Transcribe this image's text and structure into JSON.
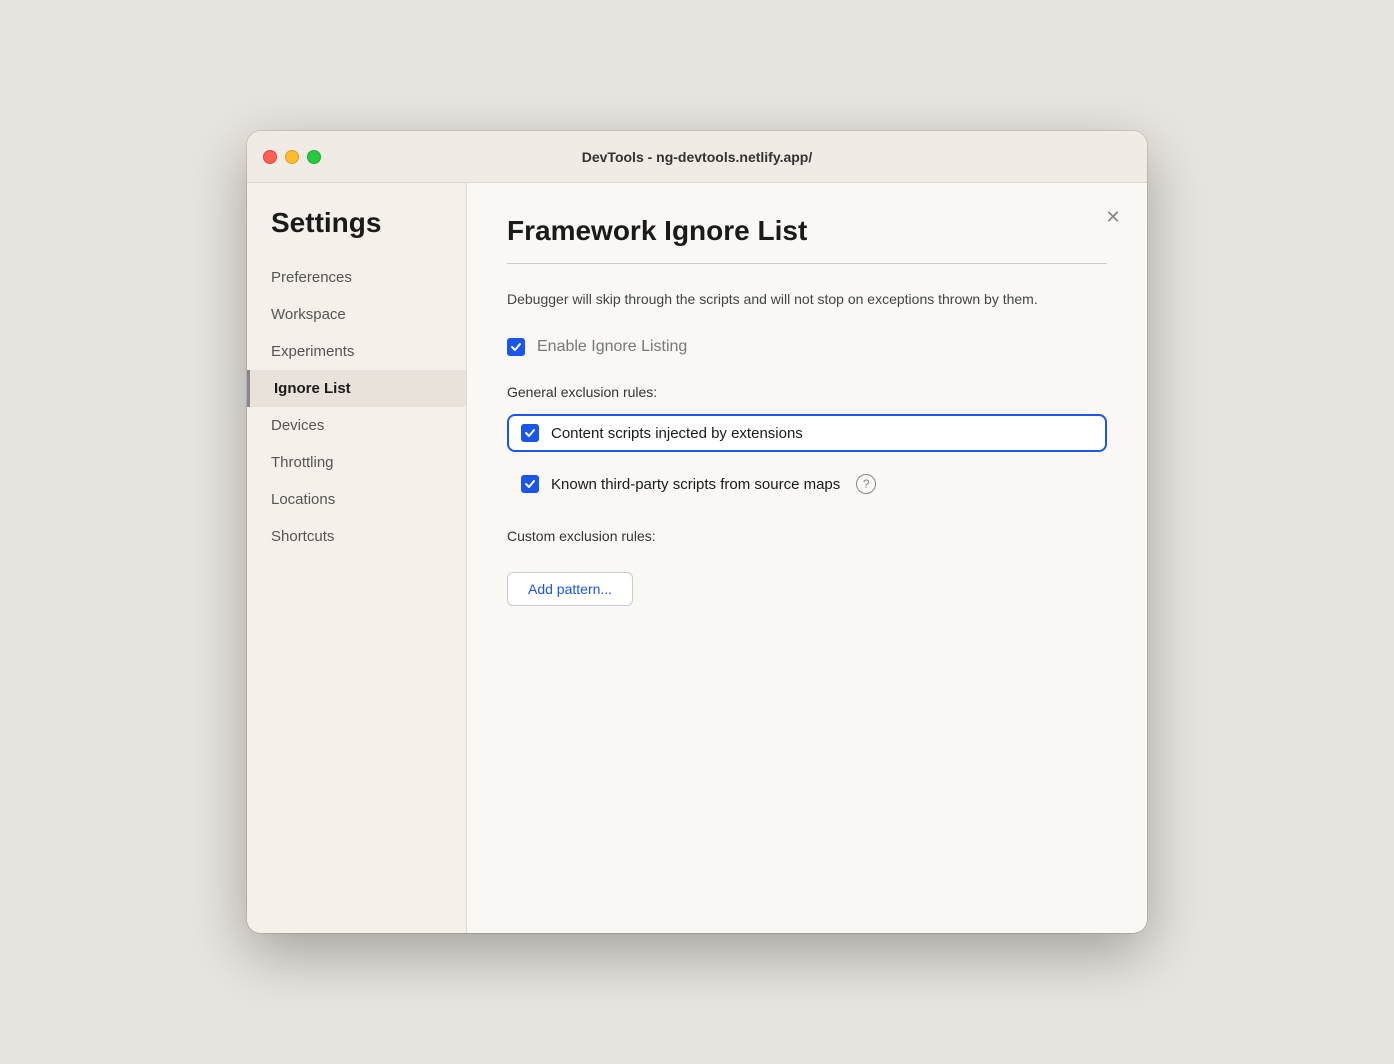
{
  "window": {
    "title": "DevTools - ng-devtools.netlify.app/"
  },
  "sidebar": {
    "title": "Settings",
    "items": [
      {
        "id": "preferences",
        "label": "Preferences",
        "active": false
      },
      {
        "id": "workspace",
        "label": "Workspace",
        "active": false
      },
      {
        "id": "experiments",
        "label": "Experiments",
        "active": false
      },
      {
        "id": "ignore-list",
        "label": "Ignore List",
        "active": true
      },
      {
        "id": "devices",
        "label": "Devices",
        "active": false
      },
      {
        "id": "throttling",
        "label": "Throttling",
        "active": false
      },
      {
        "id": "locations",
        "label": "Locations",
        "active": false
      },
      {
        "id": "shortcuts",
        "label": "Shortcuts",
        "active": false
      }
    ]
  },
  "main": {
    "page_title": "Framework Ignore List",
    "description": "Debugger will skip through the scripts and will not stop on exceptions thrown by them.",
    "enable_label": "Enable Ignore Listing",
    "general_section_label": "General exclusion rules:",
    "checkboxes": [
      {
        "id": "content-scripts",
        "label": "Content scripts injected by extensions",
        "checked": true,
        "highlighted": true,
        "has_help": false
      },
      {
        "id": "third-party-scripts",
        "label": "Known third-party scripts from source maps",
        "checked": true,
        "highlighted": false,
        "has_help": true
      }
    ],
    "custom_section_label": "Custom exclusion rules:",
    "add_pattern_btn": "Add pattern..."
  },
  "colors": {
    "checkbox_blue": "#1a56e8",
    "highlight_border": "#1a56e8"
  }
}
